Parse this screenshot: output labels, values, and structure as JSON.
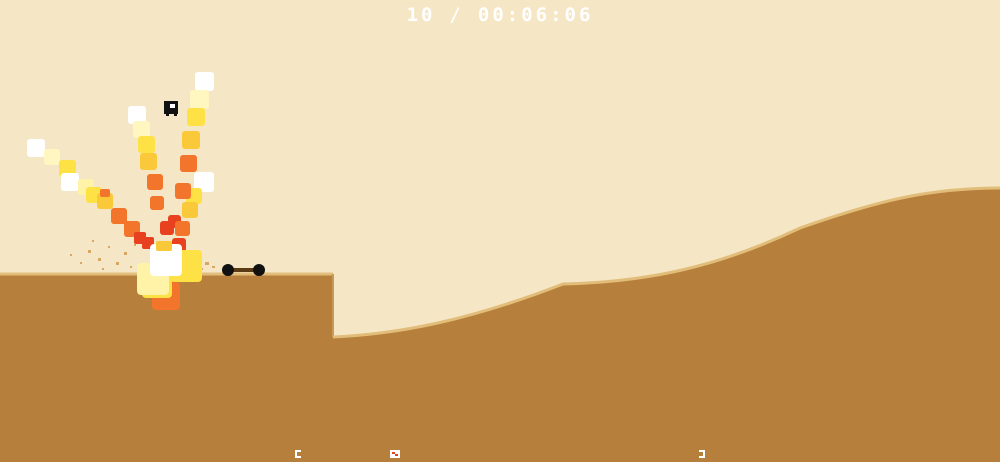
{
  "hud": {
    "score": "10",
    "separator": "/",
    "timer": "00:06:06"
  },
  "colors": {
    "sky": "#f5e7c6",
    "ground": "#b77f3c",
    "ground_edge": "#e2bd7a",
    "hud_text": "#ffffff",
    "explosion": [
      "#ffffff",
      "#fff3a8",
      "#fde145",
      "#f9c93a",
      "#f3752b",
      "#e8411f"
    ]
  },
  "icons": {
    "player": "square-creature-icon",
    "vehicle": "two-wheel-cart-icon",
    "track_start": "bracket-left-icon",
    "track_end": "bracket-right-icon",
    "track_position": "position-marker-icon"
  }
}
